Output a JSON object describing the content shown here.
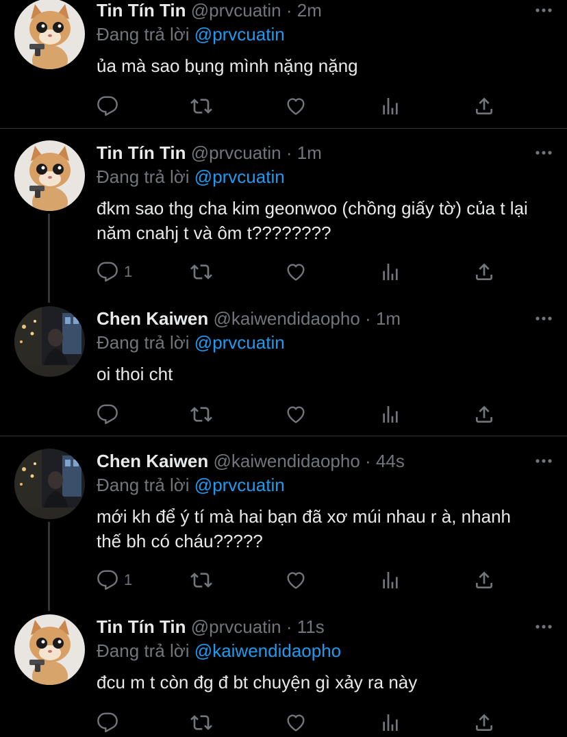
{
  "tweets": [
    {
      "name": "Tin Tín Tin",
      "handle": "@prvcuatin",
      "sep": "·",
      "time": "2m",
      "reply_prefix": "Đang trả lời",
      "reply_to": "@prvcuatin",
      "text": "ủa mà sao bụng mình nặng nặng",
      "reply_count": "",
      "avatar": "kitten-with-gun"
    },
    {
      "name": "Tin Tín Tin",
      "handle": "@prvcuatin",
      "sep": "·",
      "time": "1m",
      "reply_prefix": "Đang trả lời",
      "reply_to": "@prvcuatin",
      "text": "đkm sao thg cha kim geonwoo (chồng giấy tờ) của t lại năm cnahj t và ôm t????????",
      "reply_count": "1",
      "avatar": "kitten-with-gun"
    },
    {
      "name": "Chen Kaiwen",
      "handle": "@kaiwendidaopho",
      "sep": "·",
      "time": "1m",
      "reply_prefix": "Đang trả lời",
      "reply_to": "@prvcuatin",
      "text": "oi thoi cht",
      "reply_count": "",
      "avatar": "night-street-person"
    },
    {
      "name": "Chen Kaiwen",
      "handle": "@kaiwendidaopho",
      "sep": "·",
      "time": "44s",
      "reply_prefix": "Đang trả lời",
      "reply_to": "@prvcuatin",
      "text": "mới kh để ý tí mà hai bạn đã xơ múi nhau r à, nhanh thế bh có cháu?????",
      "reply_count": "1",
      "avatar": "night-street-person"
    },
    {
      "name": "Tin Tín Tin",
      "handle": "@prvcuatin",
      "sep": "·",
      "time": "11s",
      "reply_prefix": "Đang trả lời",
      "reply_to": "@kaiwendidaopho",
      "text": "đcu m t còn đg đ bt chuyện gì xảy ra này",
      "reply_count": "",
      "avatar": "kitten-with-gun"
    }
  ],
  "icons": {
    "reply": "reply-icon",
    "retweet": "retweet-icon",
    "like": "heart-icon",
    "views": "views-icon",
    "share": "share-icon",
    "more": "more-icon"
  },
  "colors": {
    "background": "#000000",
    "text": "#e7e9ea",
    "secondary": "#71767b",
    "accent": "#1d9bf0",
    "divider": "#2f3336"
  }
}
